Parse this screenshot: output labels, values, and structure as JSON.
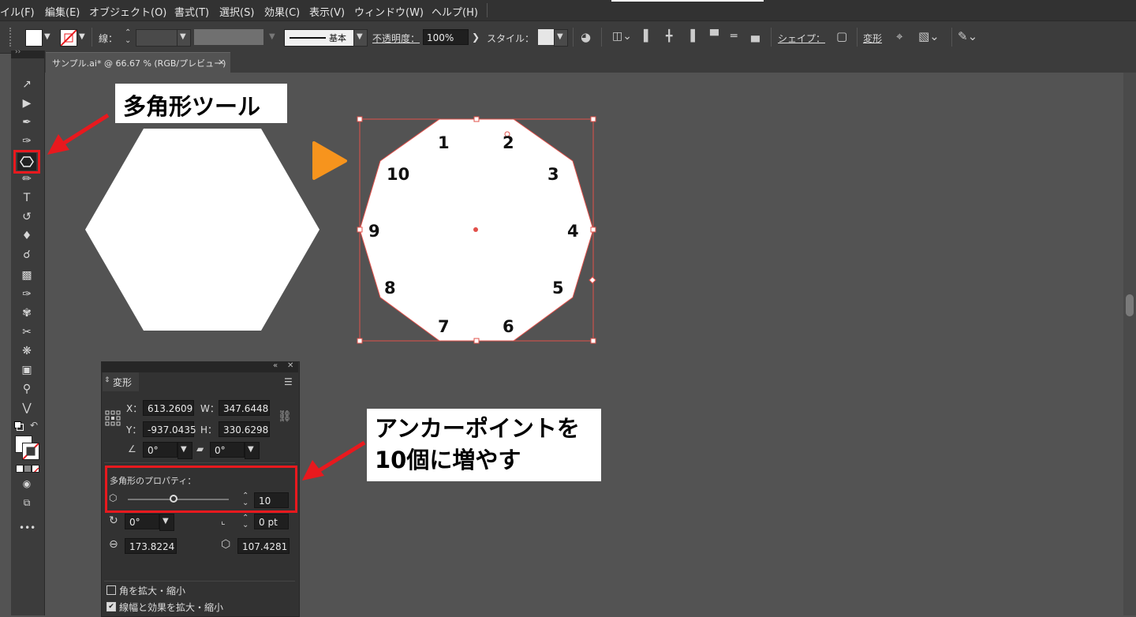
{
  "menubar": {
    "items": [
      "イル(F)",
      "編集(E)",
      "オブジェクト(O)",
      "書式(T)",
      "選択(S)",
      "効果(C)",
      "表示(V)",
      "ウィンドウ(W)",
      "ヘルプ(H)"
    ]
  },
  "controlbar": {
    "stroke_label": "線：",
    "stroke_style": "基本",
    "opacity_label": "不透明度：",
    "opacity_value": "100%",
    "style_label": "スタイル：",
    "shape_label": "シェイプ：",
    "transform_label": "変形"
  },
  "document": {
    "tab_title": "サンプル.ai* @ 66.67 % (RGB/プレビュー)",
    "close_glyph": "×"
  },
  "callouts": {
    "polygon_tool": "多角形ツール",
    "anchor_line1": "アンカーポイントを",
    "anchor_line2": "10個に増やす"
  },
  "decagon": {
    "vertex_labels": [
      "1",
      "2",
      "3",
      "4",
      "5",
      "6",
      "7",
      "8",
      "9",
      "10"
    ]
  },
  "transform_panel": {
    "tab": "変形",
    "x_label": "X：",
    "x_value": "613.2609",
    "y_label": "Y：",
    "y_value": "-937.0435",
    "w_label": "W：",
    "w_value": "347.6448",
    "h_label": "H：",
    "h_value": "330.6298",
    "angle_value": "0°",
    "shear_value": "0°",
    "polygon_section": "多角形のプロパティ：",
    "sides_value": "10",
    "sides_fraction": 0.45,
    "rotate_value": "0°",
    "corner_value": "0 pt",
    "radius_value": "173.8224",
    "side_length_value": "107.4281",
    "scale_corners_label": "角を拡大・縮小",
    "scale_strokes_label": "線幅と効果を拡大・縮小"
  },
  "colors": {
    "highlight_red": "#e8191e",
    "accent_orange": "#f7941d",
    "selection_red": "#e2504a"
  }
}
